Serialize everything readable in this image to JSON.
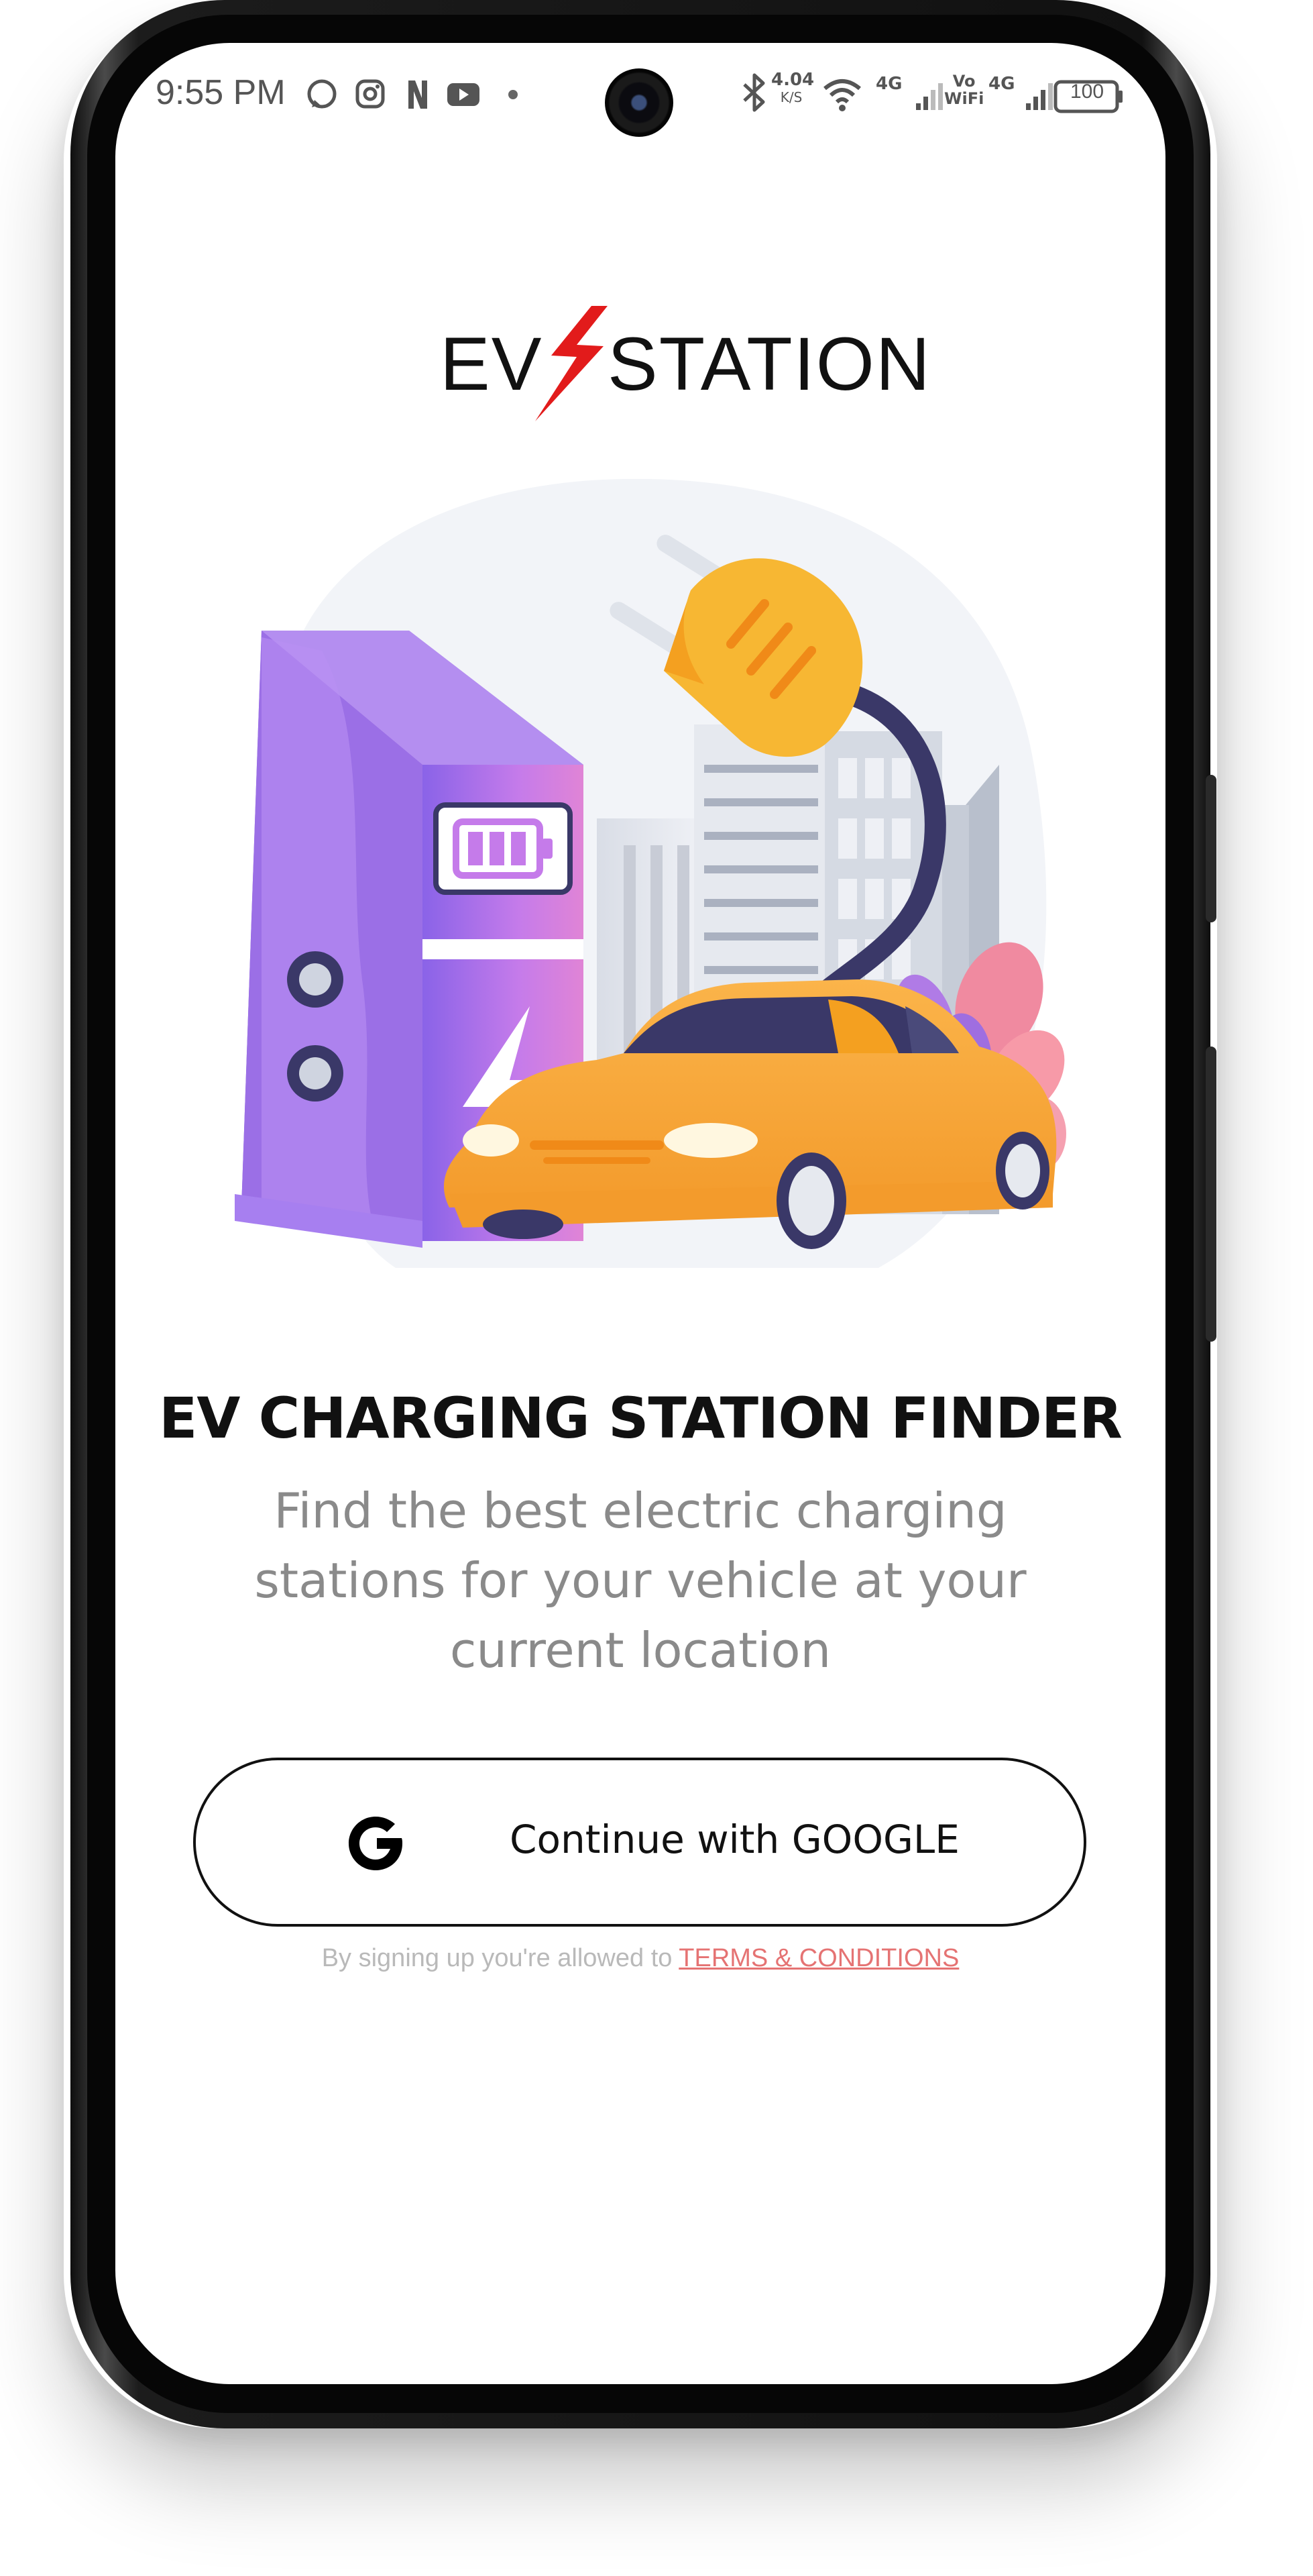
{
  "status_bar": {
    "time": "9:55 PM",
    "net_speed_value": "4.04",
    "net_speed_unit": "K/S",
    "net1": "4G",
    "volte_top": "Vo",
    "volte_bottom": "WiFi",
    "net2": "4G",
    "battery": "100"
  },
  "logo": {
    "left": "EV",
    "right": "STATION",
    "bolt_color": "#e21b1b"
  },
  "main": {
    "title": "EV CHARGING STATION FINDER",
    "subtitle_lines": [
      "Find the best electric charging",
      "stations for your vehicle at your",
      "current location"
    ]
  },
  "auth": {
    "google_button_label": "Continue with GOOGLE"
  },
  "terms": {
    "prefix": "By signing up you're allowed to ",
    "link_label": "TERMS & CONDITIONS"
  },
  "colors": {
    "accent": "#e57373",
    "car": "#f8a93a",
    "station": "#c57bea",
    "plug": "#f7b733"
  }
}
